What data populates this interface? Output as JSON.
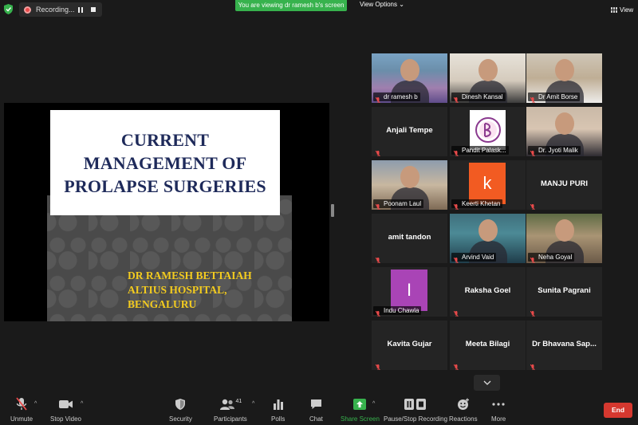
{
  "topbar": {
    "recording_label": "Recording...",
    "viewing_banner": "You are viewing dr ramesh b's screen",
    "view_options_label": "View Options",
    "view_label": "View"
  },
  "slide": {
    "title_lines": [
      "CURRENT",
      "MANAGEMENT OF",
      "PROLAPSE SURGERIES"
    ],
    "author_lines": [
      "DR RAMESH BETTAIAH",
      "ALTIUS HOSPITAL,",
      "BENGALURU"
    ]
  },
  "participants": [
    {
      "name": "dr ramesh b",
      "type": "video",
      "active": true
    },
    {
      "name": "Dinesh Kansal",
      "type": "video"
    },
    {
      "name": "Dr Amit Borse",
      "type": "video"
    },
    {
      "name": "Anjali Tempe",
      "type": "name"
    },
    {
      "name": "Pandit Palask...",
      "type": "logo"
    },
    {
      "name": "Dr. Jyoti Malik",
      "type": "video"
    },
    {
      "name": "Poonam Laul",
      "type": "video"
    },
    {
      "name": "Keerti Khetan",
      "type": "letter",
      "letter": "k",
      "color": "#f25b22"
    },
    {
      "name": "MANJU PURI",
      "type": "name"
    },
    {
      "name": "amit tandon",
      "type": "name"
    },
    {
      "name": "Arvind Vaid",
      "type": "video"
    },
    {
      "name": "Neha Goyal",
      "type": "video"
    },
    {
      "name": "Indu Chawla",
      "type": "letter",
      "letter": "I",
      "color": "#a944b6"
    },
    {
      "name": "Raksha Goel",
      "type": "name"
    },
    {
      "name": "Sunita Pagrani",
      "type": "name"
    },
    {
      "name": "Kavita Gujar",
      "type": "name"
    },
    {
      "name": "Meeta Bilagi",
      "type": "name"
    },
    {
      "name": "Dr  Bhavana Sap...",
      "type": "name"
    }
  ],
  "toolbar": {
    "unmute": "Unmute",
    "stop_video": "Stop Video",
    "security": "Security",
    "participants": "Participants",
    "participants_count": "41",
    "polls": "Polls",
    "chat": "Chat",
    "share_screen": "Share Screen",
    "pause_stop_recording": "Pause/Stop Recording",
    "reactions": "Reactions",
    "more": "More",
    "end": "End"
  },
  "colors": {
    "accent_green": "#37b24d",
    "end_red": "#d5382f",
    "slide_title": "#1e2a5a",
    "slide_author": "#f3cb1f"
  }
}
